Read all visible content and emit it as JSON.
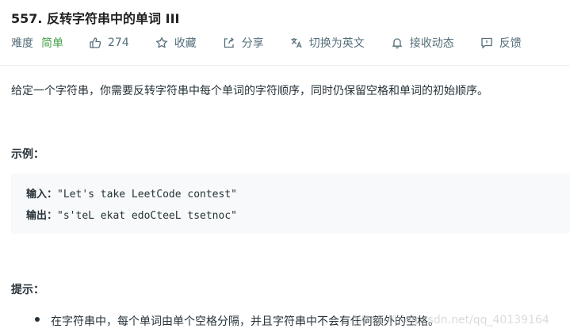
{
  "problem": {
    "title": "557. 反转字符串中的单词 III",
    "difficulty_label": "难度",
    "difficulty": "简单",
    "likes": "274",
    "collect": "收藏",
    "share": "分享",
    "switch_lang": "切换为英文",
    "notifications": "接收动态",
    "feedback": "反馈",
    "description": "给定一个字符串，你需要反转字符串中每个单词的字符顺序，同时仍保留空格和单词的初始顺序。",
    "example_heading": "示例：",
    "input_label": "输入：",
    "input_value": "\"Let's take LeetCode contest\"",
    "output_label": "输出：",
    "output_value": "\"s'teL ekat edoCteeL tsetnoc\"",
    "hint_heading": "提示：",
    "hints": [
      "在字符串中，每个单词由单个空格分隔，并且字符串中不会有任何额外的空格。"
    ]
  },
  "watermark": "https://blog.csdn.net/qq_40139164",
  "colors": {
    "accent_green": "#43a047",
    "meta_gray": "#546e7a",
    "code_bg": "#f7f9fa"
  },
  "icons": [
    "thumbs-up-icon",
    "star-icon",
    "share-icon",
    "translate-icon",
    "bell-icon",
    "feedback-icon"
  ]
}
